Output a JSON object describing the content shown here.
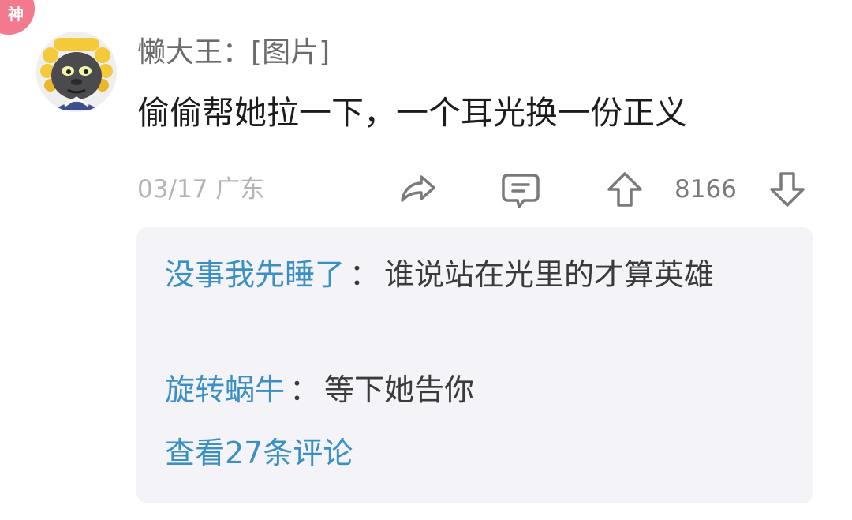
{
  "badge": {
    "label": "神",
    "color": "#f3798f"
  },
  "comment": {
    "username": "懒大王",
    "separator": "：",
    "image_tag": "[图片]",
    "text": "偷偷帮她拉一下，一个耳光换一份正义",
    "date": "03/17",
    "location": "广东",
    "vote_count": "8166"
  },
  "actions": {
    "share_icon": "share-icon",
    "reply_icon": "comment-icon",
    "upvote_icon": "arrow-up-icon",
    "downvote_icon": "arrow-down-icon"
  },
  "replies": [
    {
      "author": "没事我先睡了",
      "separator": "：",
      "text": "谁说站在光里的才算英雄"
    },
    {
      "author": "旋转蜗牛",
      "separator": "：",
      "text": "等下她告你"
    }
  ],
  "view_more": "查看27条评论",
  "colors": {
    "link": "#3a8fc4",
    "reply_background": "#f4f4f8",
    "meta_text": "#b4b4b4"
  }
}
